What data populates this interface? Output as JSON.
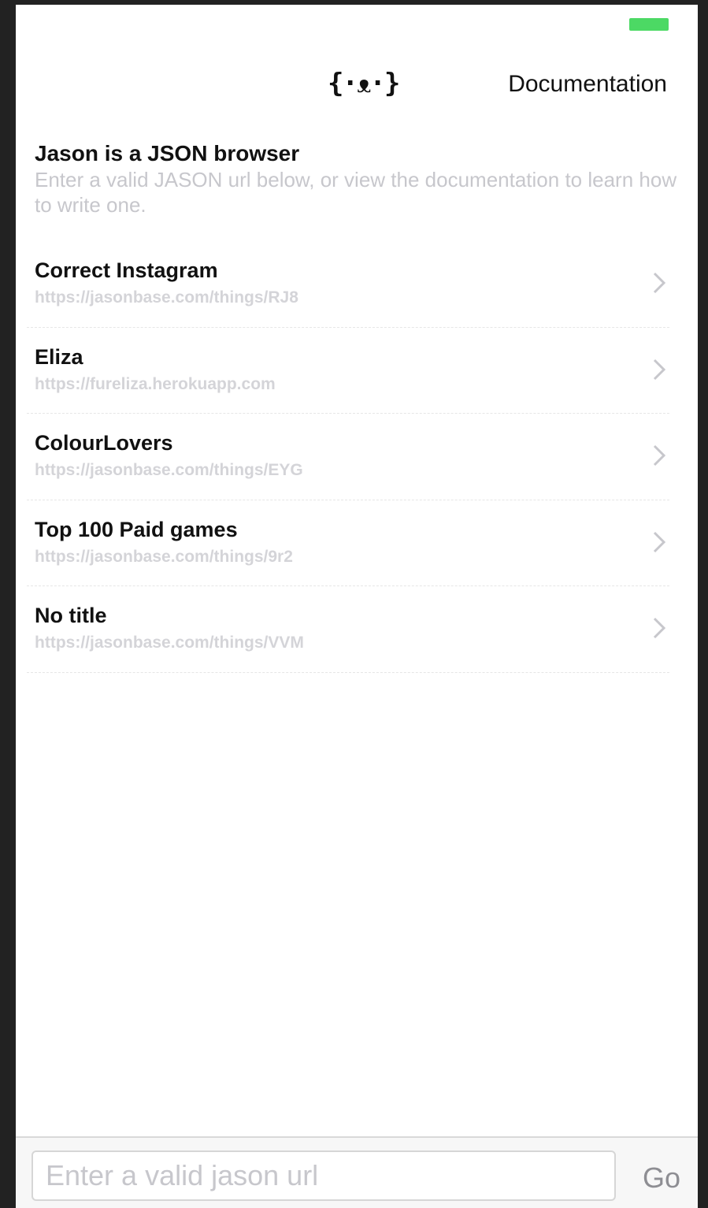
{
  "colors": {
    "battery": "#4cd964",
    "background": "#222222",
    "screen": "#ffffff",
    "muted_text": "#c7c7cc"
  },
  "navbar": {
    "logo": "{·ᴥ·}",
    "documentation_label": "Documentation"
  },
  "header": {
    "title": "Jason is a JSON browser",
    "description": "Enter a valid JASON url below, or view the documentation to learn how to write one."
  },
  "list": {
    "items": [
      {
        "title": "Correct Instagram",
        "url": "https://jasonbase.com/things/RJ8"
      },
      {
        "title": "Eliza",
        "url": "https://fureliza.herokuapp.com"
      },
      {
        "title": "ColourLovers",
        "url": "https://jasonbase.com/things/EYG"
      },
      {
        "title": "Top 100 Paid games",
        "url": "https://jasonbase.com/things/9r2"
      },
      {
        "title": "No title",
        "url": "https://jasonbase.com/things/VVM"
      }
    ]
  },
  "bottom_bar": {
    "input_placeholder": "Enter a valid jason url",
    "input_value": "",
    "go_label": "Go"
  }
}
